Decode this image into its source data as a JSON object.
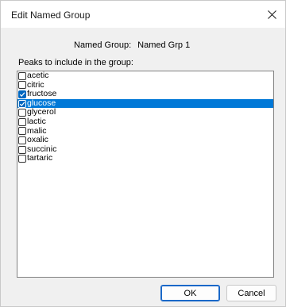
{
  "window": {
    "title": "Edit Named Group"
  },
  "named_group": {
    "label": "Named Group:",
    "value": "Named Grp 1"
  },
  "peaks": {
    "label": "Peaks to include in the group:",
    "items": [
      {
        "label": "acetic",
        "checked": false,
        "selected": false
      },
      {
        "label": "citric",
        "checked": false,
        "selected": false
      },
      {
        "label": "fructose",
        "checked": true,
        "selected": false
      },
      {
        "label": "glucose",
        "checked": true,
        "selected": true
      },
      {
        "label": "glycerol",
        "checked": false,
        "selected": false
      },
      {
        "label": "lactic",
        "checked": false,
        "selected": false
      },
      {
        "label": "malic",
        "checked": false,
        "selected": false
      },
      {
        "label": "oxalic",
        "checked": false,
        "selected": false
      },
      {
        "label": "succinic",
        "checked": false,
        "selected": false
      },
      {
        "label": "tartaric",
        "checked": false,
        "selected": false
      }
    ]
  },
  "buttons": {
    "ok_label": "OK",
    "cancel_label": "Cancel"
  },
  "colors": {
    "selection": "#0078d7",
    "checkbox_checked": "#0067c0",
    "default_button_border": "#1a68c8"
  },
  "icons": {
    "close": "close-icon",
    "checkbox": "checkmark-icon"
  }
}
